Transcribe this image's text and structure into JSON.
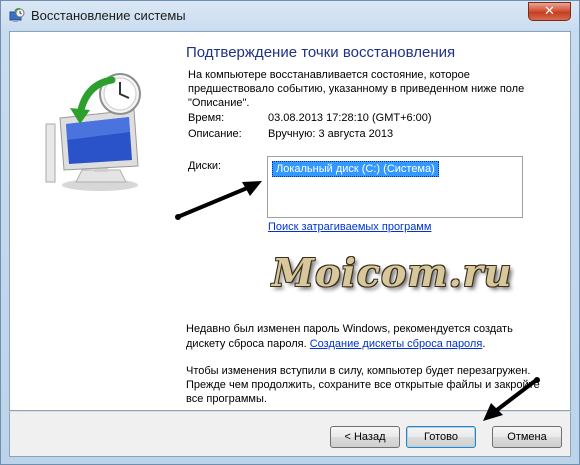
{
  "window": {
    "title": "Восстановление системы",
    "close_glyph": "✕"
  },
  "main": {
    "heading": "Подтверждение точки восстановления",
    "description": "На компьютере восстанавливается состояние, которое предшествовало событию, указанному в приведенном ниже поле \"Описание\".",
    "time_label": "Время:",
    "time_value": "03.08.2013 17:28:10 (GMT+6:00)",
    "desc_label": "Описание:",
    "desc_value": "Вручную: 3 августа 2013",
    "disks_label": "Диски:",
    "disks": [
      "Локальный диск (C:) (Система)"
    ],
    "scan_link": "Поиск затрагиваемых программ",
    "watermark": "Moicom.ru",
    "password_text_1": "Недавно был изменен пароль Windows, рекомендуется создать дискету сброса пароля. ",
    "password_link": "Создание дискеты сброса пароля",
    "password_text_2": ".",
    "restart_text": "Чтобы изменения вступили в силу, компьютер будет перезагружен. Прежде чем продолжить, сохраните все открытые файлы и закройте все программы."
  },
  "buttons": {
    "back": "< Назад",
    "finish": "Готово",
    "cancel": "Отмена"
  },
  "icons": {
    "title": "system-restore-icon",
    "hero": "computer-restore-icon"
  },
  "colors": {
    "heading": "#1e3287",
    "link": "#0033cc",
    "selection": "#3399ff"
  }
}
